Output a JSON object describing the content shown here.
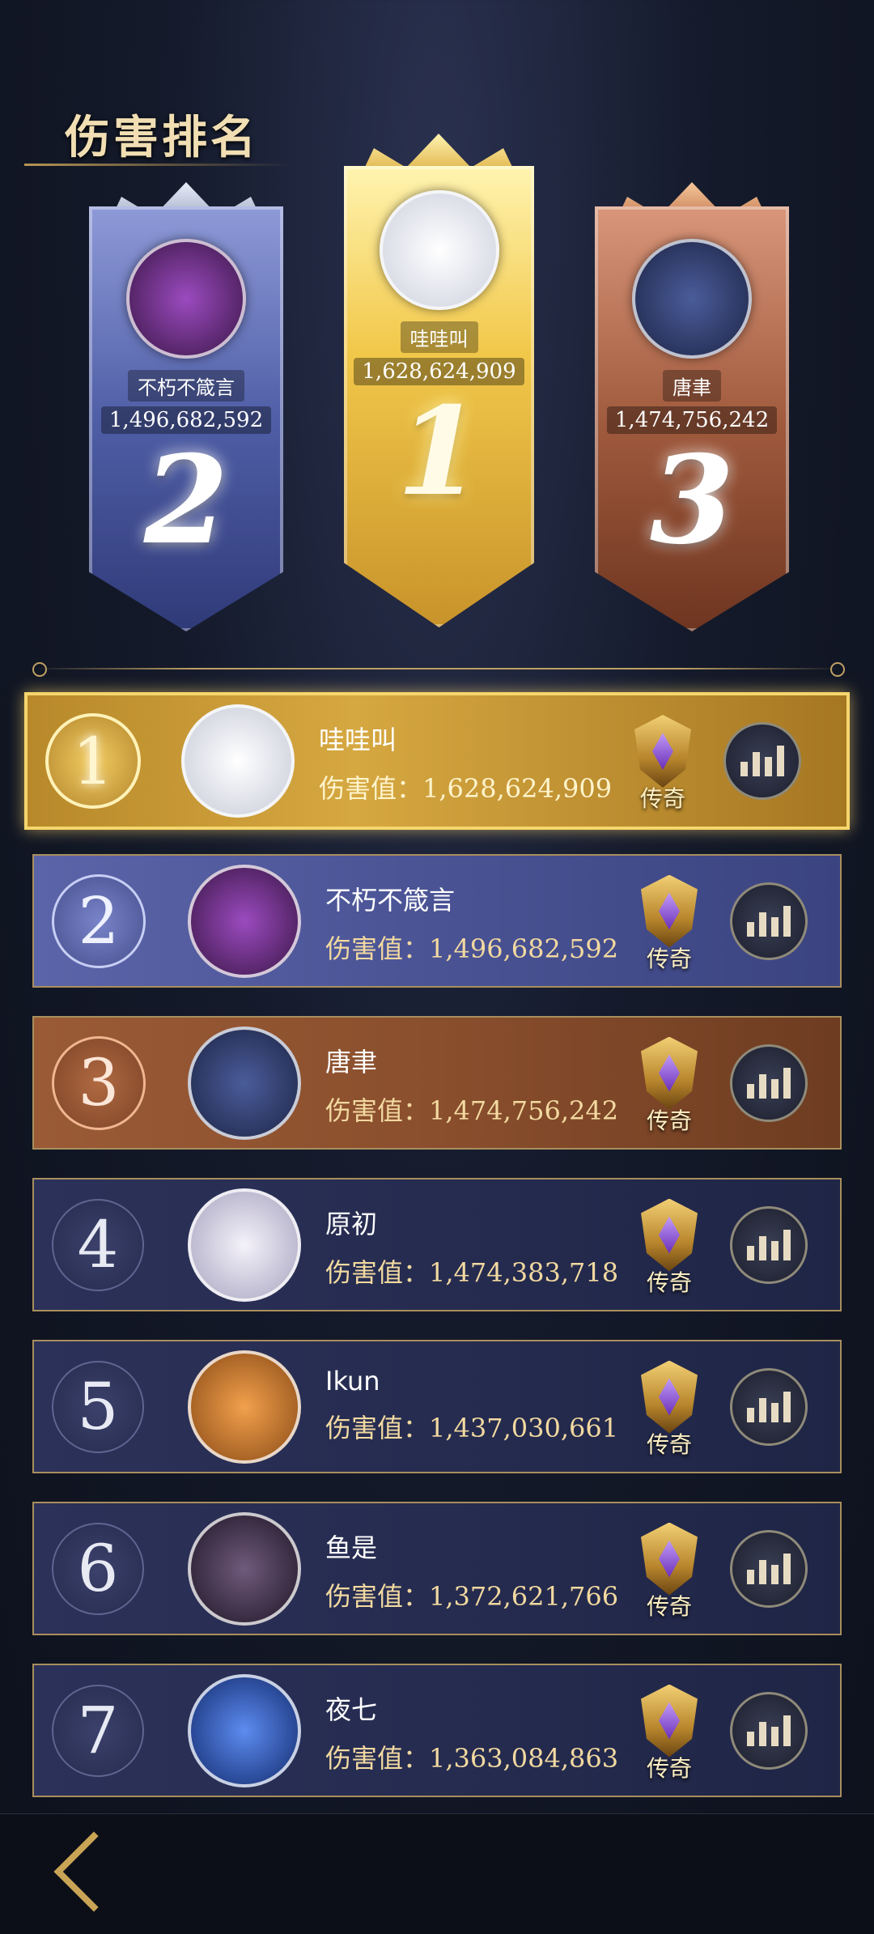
{
  "header": {
    "title": "伤害排名"
  },
  "podium": [
    {
      "rank": "2",
      "name": "不朽不箴言",
      "score": "1,496,682,592",
      "avatar_color": "#5a2c6e"
    },
    {
      "rank": "1",
      "name": "哇哇叫",
      "score": "1,628,624,909",
      "avatar_color": "#e9e9ef"
    },
    {
      "rank": "3",
      "name": "唐聿",
      "score": "1,474,756,242",
      "avatar_color": "#2d3a66"
    }
  ],
  "score_label": "伤害值：",
  "tier_label": "传奇",
  "rows": [
    {
      "rank": "1",
      "name": "哇哇叫",
      "score": "1,628,624,909",
      "avatar_color": "#e9e9ef"
    },
    {
      "rank": "2",
      "name": "不朽不箴言",
      "score": "1,496,682,592",
      "avatar_color": "#5a2c6e"
    },
    {
      "rank": "3",
      "name": "唐聿",
      "score": "1,474,756,242",
      "avatar_color": "#2d3a66"
    },
    {
      "rank": "4",
      "name": "原初",
      "score": "1,474,383,718",
      "avatar_color": "#d9d6e6"
    },
    {
      "rank": "5",
      "name": "Ikun",
      "score": "1,437,030,661",
      "avatar_color": "#d9822f"
    },
    {
      "rank": "6",
      "name": "鱼是",
      "score": "1,372,621,766",
      "avatar_color": "#3b2a44"
    },
    {
      "rank": "7",
      "name": "夜七",
      "score": "1,363,084,863",
      "avatar_color": "#2550a8"
    }
  ],
  "icons": {
    "stats": "bar-chart-icon",
    "tier": "legend-shield-icon",
    "back": "back-arrow-icon"
  }
}
